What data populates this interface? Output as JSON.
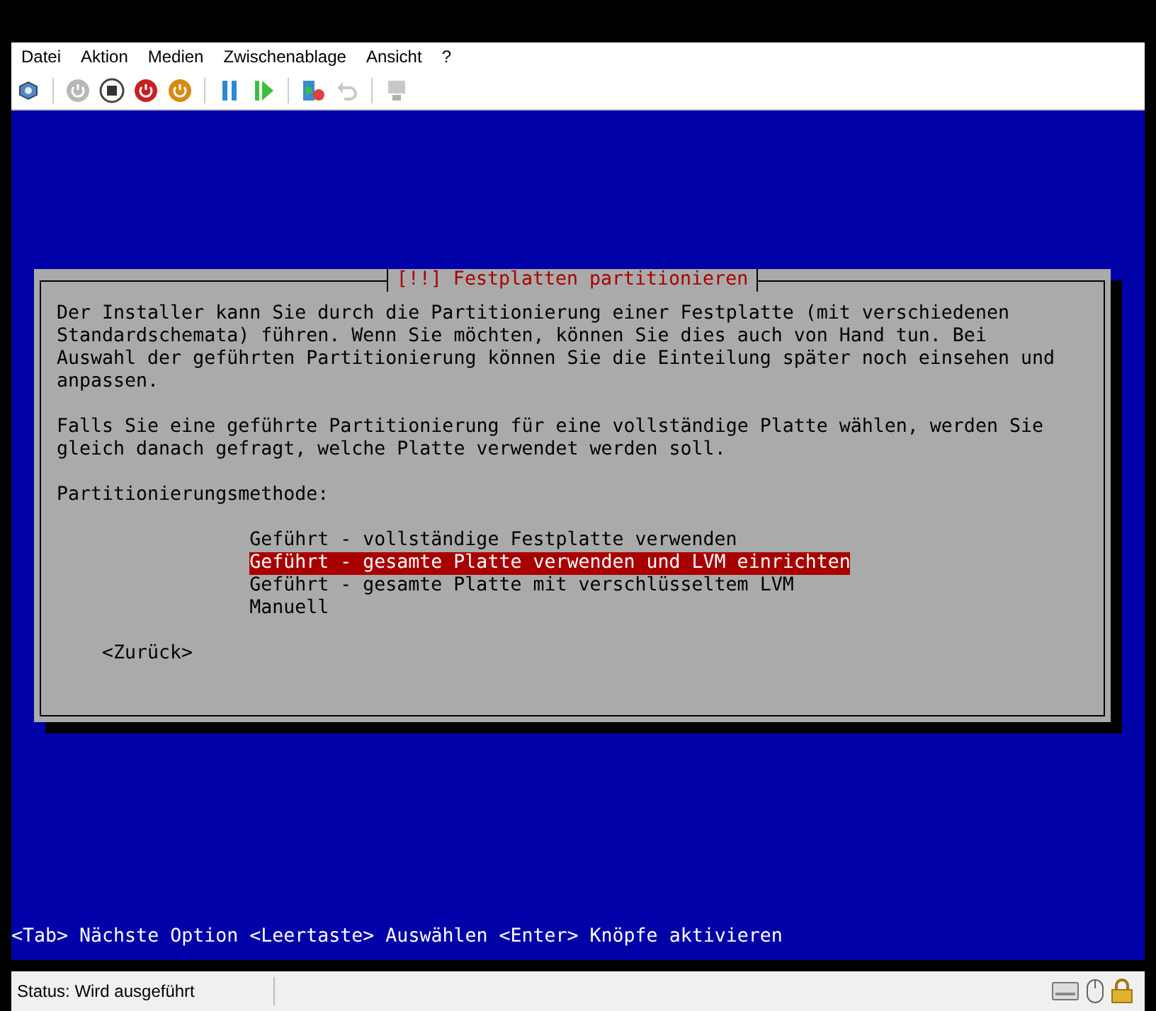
{
  "menu": [
    "Datei",
    "Aktion",
    "Medien",
    "Zwischenablage",
    "Ansicht",
    "?"
  ],
  "dialog": {
    "title": "[!!] Festplatten partitionieren",
    "paragraphs": [
      "Der Installer kann Sie durch die Partitionierung einer Festplatte (mit verschiedenen Standardschemata) führen. Wenn Sie möchten, können Sie dies auch von Hand tun. Bei Auswahl der geführten Partitionierung können Sie die Einteilung später noch einsehen und anpassen.",
      "Falls Sie eine geführte Partitionierung für eine vollständige Platte wählen, werden Sie gleich danach gefragt, welche Platte verwendet werden soll."
    ],
    "prompt": "Partitionierungsmethode:",
    "options": [
      {
        "label": "Geführt - vollständige Festplatte verwenden",
        "selected": false
      },
      {
        "label": "Geführt - gesamte Platte verwenden und LVM einrichten",
        "selected": true
      },
      {
        "label": "Geführt - gesamte Platte mit verschlüsseltem LVM",
        "selected": false
      },
      {
        "label": "Manuell",
        "selected": false
      }
    ],
    "back_button": "<Zurück>"
  },
  "hint": "<Tab> Nächste Option <Leertaste> Auswählen <Enter> Knöpfe aktivieren",
  "status_bar": {
    "text": "Status: Wird ausgeführt"
  }
}
